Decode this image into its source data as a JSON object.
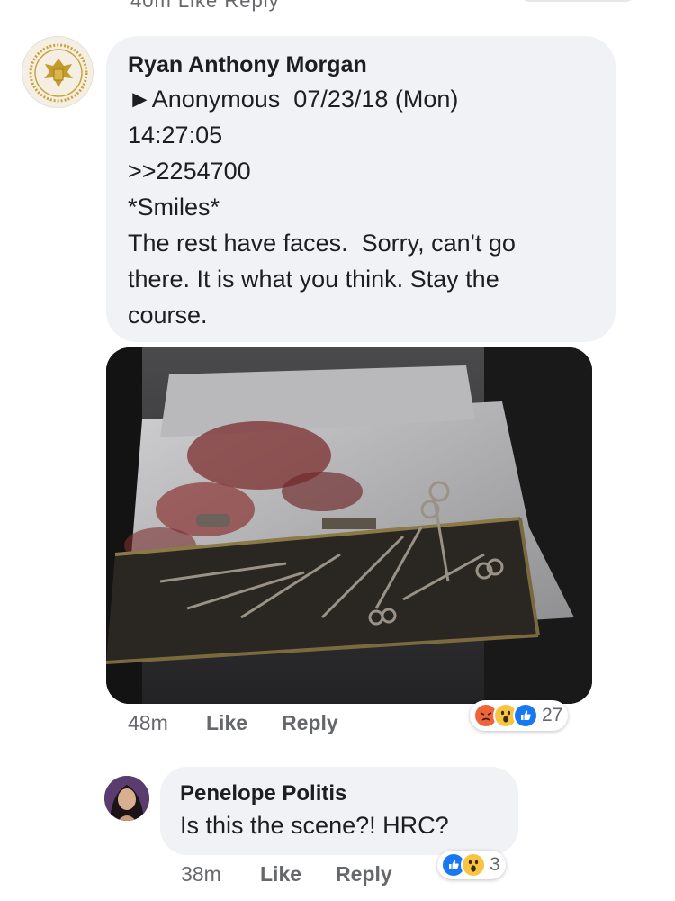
{
  "top_partial": {
    "text": "40m   Like   Reply"
  },
  "comment": {
    "author": "Ryan Anthony Morgan",
    "lines": [
      "►Anonymous  07/23/18 (Mon)",
      "14:27:05",
      ">>2254700",
      "*Smiles*",
      "The rest have faces.  Sorry, can't go",
      "there. It is what you think. Stay the",
      "course."
    ],
    "time": "48m",
    "like_label": "Like",
    "reply_label": "Reply",
    "reactions": {
      "icons": [
        "angry-icon",
        "wow-icon",
        "like-icon"
      ],
      "count": "27"
    }
  },
  "reply": {
    "author": "Penelope Politis",
    "text": "Is this the scene?! HRC?",
    "time": "38m",
    "like_label": "Like",
    "reply_label": "Reply",
    "reactions": {
      "icons": [
        "like-icon",
        "wow-icon"
      ],
      "count": "3"
    }
  },
  "colors": {
    "bubble": "#f0f2f5",
    "meta_text": "#65676b",
    "like_blue": "#1877f2",
    "angry_orange": "#f0643c",
    "wow_yellow": "#f7c443"
  }
}
